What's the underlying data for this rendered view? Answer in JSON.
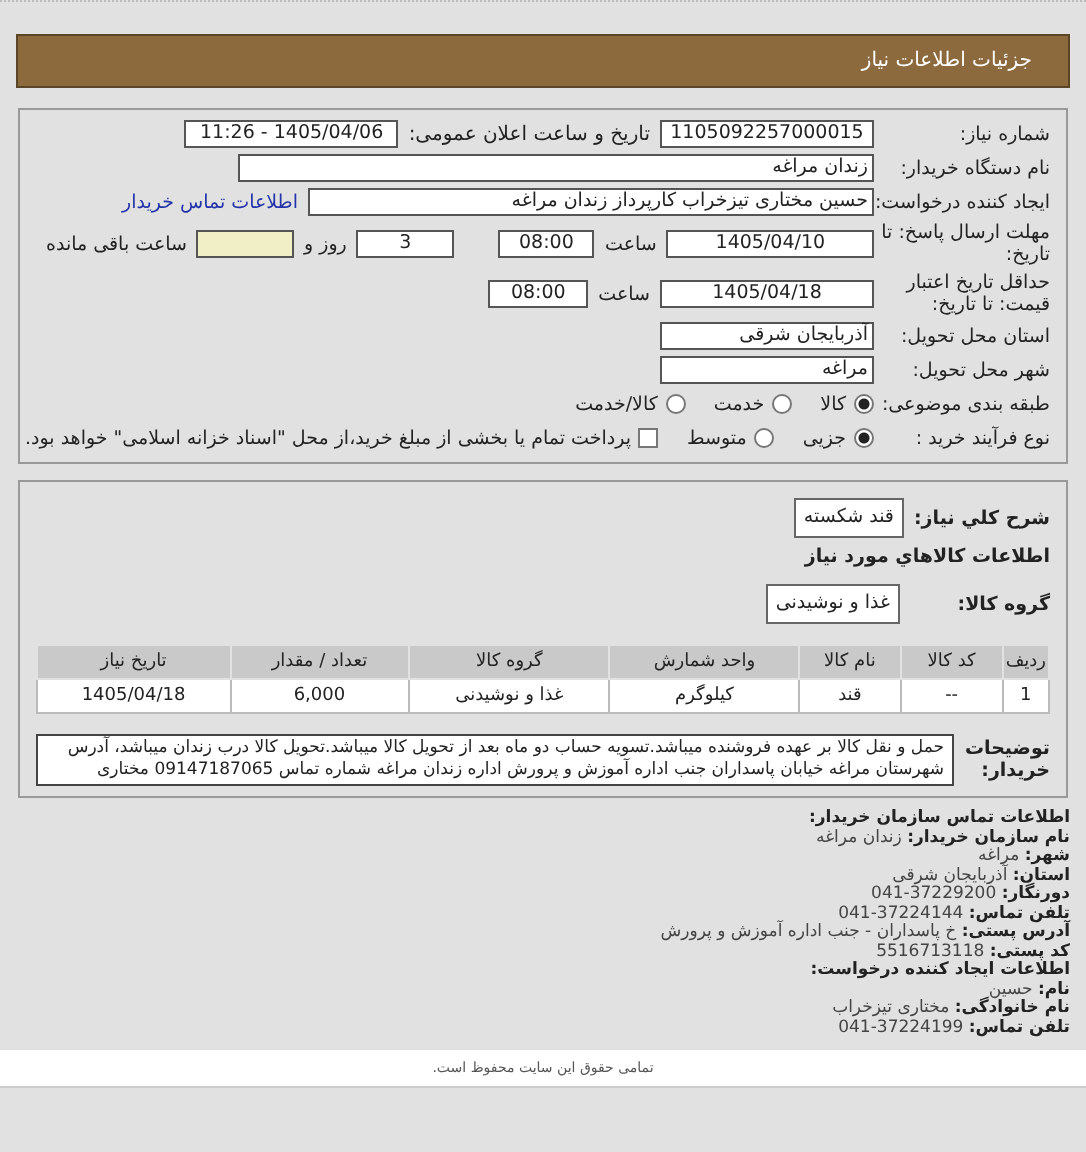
{
  "header": {
    "title": "جزئیات اطلاعات نیاز"
  },
  "details": {
    "need_number": {
      "label": "شماره نیاز:",
      "value": "1105092257000015"
    },
    "announce": {
      "label": "تاریخ و ساعت اعلان عمومی:",
      "value": "1405/04/06 - 11:26"
    },
    "buyer": {
      "label": "نام دستگاه خریدار:",
      "value": "زندان مراغه"
    },
    "requester": {
      "label": "ایجاد کننده درخواست:",
      "value": "حسین مختاری تیزخراب کارپرداز زندان مراغه",
      "link": "اطلاعات تماس خریدار"
    },
    "deadline": {
      "label": "مهلت ارسال پاسخ: تا تاریخ:",
      "date": "1405/04/10",
      "time_label": "ساعت",
      "time": "08:00",
      "days": "3",
      "days_label": "روز و",
      "remaining_label": "ساعت باقی مانده"
    },
    "validity": {
      "label": "حداقل تاریخ اعتبار قیمت: تا تاریخ:",
      "date": "1405/04/18",
      "time_label": "ساعت",
      "time": "08:00"
    },
    "province": {
      "label": "استان محل تحویل:",
      "value": "آذربایجان شرقی"
    },
    "city": {
      "label": "شهر محل تحویل:",
      "value": "مراغه"
    },
    "category": {
      "label": "طبقه بندی موضوعی:",
      "options": [
        {
          "kind": "radio",
          "label": "کالا",
          "selected": true
        },
        {
          "kind": "radio",
          "label": "خدمت",
          "selected": false
        },
        {
          "kind": "radio",
          "label": "کالا/خدمت",
          "selected": false
        }
      ]
    },
    "process": {
      "label": "نوع فرآیند خرید :",
      "options": [
        {
          "kind": "radio",
          "label": "جزیی",
          "selected": true
        },
        {
          "kind": "radio",
          "label": "متوسط",
          "selected": false
        },
        {
          "kind": "checkbox",
          "label": "پرداخت تمام یا بخشی از مبلغ خرید،از محل \"اسناد خزانه اسلامی\" خواهد بود.",
          "selected": false
        }
      ]
    }
  },
  "goods": {
    "summary": {
      "label": "شرح کلي نياز:",
      "value": "قند شکسته"
    },
    "heading": "اطلاعات کالاهاي مورد نياز",
    "group": {
      "label": "گروه کالا:",
      "value": "غذا و نوشیدنی"
    },
    "table": {
      "columns": [
        "ردیف",
        "کد کالا",
        "نام کالا",
        "واحد شمارش",
        "گروه کالا",
        "تعداد / مقدار",
        "تاریخ نیاز"
      ],
      "rows": [
        [
          "1",
          "--",
          "قند",
          "کیلوگرم",
          "غذا و نوشیدنی",
          "6,000",
          "1405/04/18"
        ]
      ]
    },
    "notes": {
      "label": "توضیحات خریدار:",
      "text": "حمل و نقل کالا بر عهده فروشنده میباشد.تسویه حساب دو ماه بعد از تحویل کالا میباشد.تحویل کالا درب زندان میباشد، آدرس شهرستان مراغه خیابان پاسداران جنب اداره آموزش و پرورش اداره زندان مراغه شماره تماس 09147187065 مختاری"
    }
  },
  "contact": {
    "heading": "اطلاعات تماس سازمان خریدار:",
    "lines": [
      {
        "label": "نام سازمان خریدار:",
        "value": "زندان مراغه"
      },
      {
        "label": "شهر:",
        "value": "مراغه"
      },
      {
        "label": "استان:",
        "value": "آذربایجان شرقی"
      },
      {
        "label": "دورنگار:",
        "value": "37229200-041"
      },
      {
        "label": "تلفن تماس:",
        "value": "37224144-041"
      },
      {
        "label": "آدرس پستی:",
        "value": "خ پاسداران - جنب اداره آموزش و پرورش"
      },
      {
        "label": "کد پستی:",
        "value": "5516713118"
      }
    ],
    "creator_heading": "اطلاعات ایجاد کننده درخواست:",
    "creator_lines": [
      {
        "label": "نام:",
        "value": "حسین"
      },
      {
        "label": "نام خانوادگی:",
        "value": "مختاری تیزخراب"
      },
      {
        "label": "تلفن تماس:",
        "value": "37224199-041"
      }
    ]
  },
  "footer": {
    "text": "تمامی حقوق این سایت محفوظ است."
  }
}
